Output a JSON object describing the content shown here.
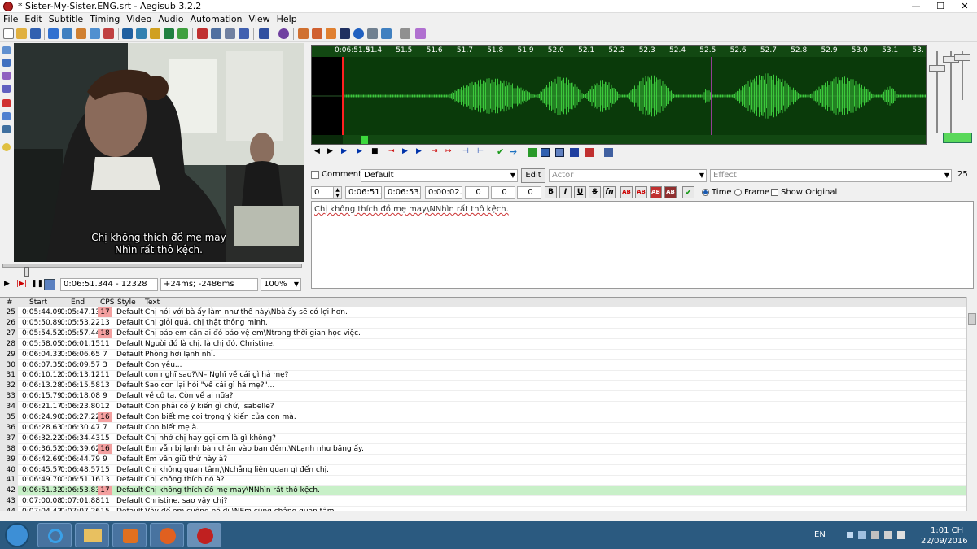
{
  "window": {
    "title": "* Sister-My-Sister.ENG.srt - Aegisub 3.2.2",
    "minimize": "—",
    "maximize": "☐",
    "close": "✕"
  },
  "menu": [
    "File",
    "Edit",
    "Subtitle",
    "Timing",
    "Video",
    "Audio",
    "Automation",
    "View",
    "Help"
  ],
  "video": {
    "subtitle_line1": "Chị không thích đồ mẹ may",
    "subtitle_line2": "Nhìn rất thô kệch.",
    "position": "0:06:51.344 - 12328",
    "offset": "+24ms; -2486ms",
    "zoom": "100%"
  },
  "audio": {
    "timeline_labels": [
      "0:06:51.3",
      "51.4",
      "51.5",
      "51.6",
      "51.7",
      "51.8",
      "51.9",
      "52.0",
      "52.1",
      "52.2",
      "52.3",
      "52.4",
      "52.5",
      "52.6",
      "52.7",
      "52.8",
      "52.9",
      "53.0",
      "53.1",
      "53."
    ],
    "wave_color": "#3cc83c"
  },
  "edit": {
    "comment_label": "Comment",
    "style": "Default",
    "edit_button": "Edit",
    "actor_placeholder": "Actor",
    "effect_placeholder": "Effect",
    "char_count": "25",
    "layer": "0",
    "start": "0:06:51.32",
    "end": "0:06:53.83",
    "duration": "0:00:02.51",
    "margin_l": "0",
    "margin_r": "0",
    "margin_v": "0",
    "bold": "B",
    "italic": "I",
    "underline": "U",
    "strike": "S",
    "font": "fn",
    "ab1": "AB",
    "ab2": "AB",
    "ab3": "AB",
    "ab4": "AB",
    "time_label": "Time",
    "frame_label": "Frame",
    "show_original_label": "Show Original",
    "text": "Chị không thích đồ mẹ may\\NNhìn rất thô kệch."
  },
  "grid": {
    "headers": {
      "num": "#",
      "start": "Start",
      "end": "End",
      "cps": "CPS",
      "style": "Style",
      "text": "Text"
    },
    "rows": [
      {
        "num": "25",
        "start": "0:05:44.09",
        "end": "0:05:47.13",
        "cps": "17",
        "style": "Default",
        "text": "Chị nói với bà ấy làm như thế này\\Nbà ấy sẽ có lợi hơn.",
        "warn": true
      },
      {
        "num": "26",
        "start": "0:05:50.89",
        "end": "0:05:53.22",
        "cps": "13",
        "style": "Default",
        "text": "Chị giỏi quá, chị thật thông minh."
      },
      {
        "num": "27",
        "start": "0:05:54.52",
        "end": "0:05:57.44",
        "cps": "18",
        "style": "Default",
        "text": "Chị bảo em cần ai đó bảo vệ em\\Ntrong thời gian học việc.",
        "warn": true
      },
      {
        "num": "28",
        "start": "0:05:58.05",
        "end": "0:06:01.15",
        "cps": "11",
        "style": "Default",
        "text": "Người đó là chị, là chị đó, Christine."
      },
      {
        "num": "29",
        "start": "0:06:04.33",
        "end": "0:06:06.65",
        "cps": "7",
        "style": "Default",
        "text": "Phòng hơi lạnh nhỉ."
      },
      {
        "num": "30",
        "start": "0:06:07.35",
        "end": "0:06:09.57",
        "cps": "3",
        "style": "Default",
        "text": "Con yêu..."
      },
      {
        "num": "31",
        "start": "0:06:10.12",
        "end": "0:06:13.12",
        "cps": "11",
        "style": "Default",
        "text": "con nghĩ sao?\\N– Nghĩ về cái gì hả mẹ?"
      },
      {
        "num": "32",
        "start": "0:06:13.28",
        "end": "0:06:15.58",
        "cps": "13",
        "style": "Default",
        "text": "Sao con lại hỏi \"về cái gì hả mẹ?\"..."
      },
      {
        "num": "33",
        "start": "0:06:15.79",
        "end": "0:06:18.08",
        "cps": "9",
        "style": "Default",
        "text": "về cô ta. Còn về ai nữa?"
      },
      {
        "num": "34",
        "start": "0:06:21.17",
        "end": "0:06:23.80",
        "cps": "12",
        "style": "Default",
        "text": "Con phải có ý kiến gì chứ, Isabelle?"
      },
      {
        "num": "35",
        "start": "0:06:24.90",
        "end": "0:06:27.22",
        "cps": "16",
        "style": "Default",
        "text": "Con biết mẹ coi trọng ý kiến của con mà.",
        "warn": true
      },
      {
        "num": "36",
        "start": "0:06:28.63",
        "end": "0:06:30.47",
        "cps": "7",
        "style": "Default",
        "text": "Con biết mẹ à."
      },
      {
        "num": "37",
        "start": "0:06:32.22",
        "end": "0:06:34.43",
        "cps": "15",
        "style": "Default",
        "text": "Chị nhớ chị hay gọi em là gì không?"
      },
      {
        "num": "38",
        "start": "0:06:36.52",
        "end": "0:06:39.62",
        "cps": "16",
        "style": "Default",
        "text": "Em vẫn bị lạnh bàn chân vào ban đêm.\\NLạnh như băng ấy.",
        "warn": true
      },
      {
        "num": "39",
        "start": "0:06:42.69",
        "end": "0:06:44.79",
        "cps": "9",
        "style": "Default",
        "text": "Em vẫn giữ thứ này à?"
      },
      {
        "num": "40",
        "start": "0:06:45.57",
        "end": "0:06:48.57",
        "cps": "15",
        "style": "Default",
        "text": "Chị không quan tâm,\\Nchẳng liên quan gì đến chị."
      },
      {
        "num": "41",
        "start": "0:06:49.70",
        "end": "0:06:51.16",
        "cps": "13",
        "style": "Default",
        "text": "Chị không thích nó à?"
      },
      {
        "num": "42",
        "start": "0:06:51.32",
        "end": "0:06:53.83",
        "cps": "17",
        "style": "Default",
        "text": "Chị không thích đồ mẹ may\\NNhìn rất thô kệch.",
        "warn": true,
        "active": true
      },
      {
        "num": "43",
        "start": "0:07:00.08",
        "end": "0:07:01.88",
        "cps": "11",
        "style": "Default",
        "text": "Christine, sao vậy chị?"
      },
      {
        "num": "44",
        "start": "0:07:04.42",
        "end": "0:07:07.26",
        "cps": "15",
        "style": "Default",
        "text": "Vậy để em cuộng nó đi.\\NEm cũng chẳng quan tâm."
      }
    ]
  },
  "taskbar": {
    "lang": "EN",
    "time": "1:01 CH",
    "date": "22/09/2016"
  },
  "colors": {
    "warn_cps": "#f4a0a0",
    "active_row": "#c8f0c8",
    "wave_bg": "#000000",
    "timeline_bg": "#124812",
    "taskbar": "#2b5a80"
  }
}
